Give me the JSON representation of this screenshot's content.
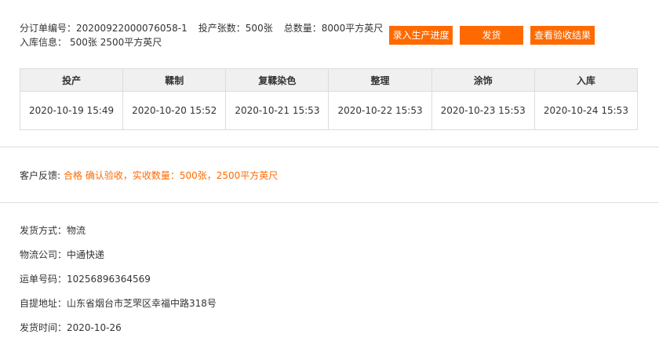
{
  "order": {
    "order_no_label": "分订单编号：",
    "order_no": "20200922000076058-1",
    "sheets_label": "投产张数：",
    "sheets": "500张",
    "total_label": "总数量：",
    "total": "8000平方英尺",
    "storage_label": "入库信息：",
    "storage": "500张 2500平方英尺"
  },
  "actions": {
    "record_progress": "录入生产进度",
    "ship": "发货",
    "view_result": "查看验收结果"
  },
  "steps": {
    "headers": [
      "投产",
      "鞣制",
      "复鞣染色",
      "整理",
      "涂饰",
      "入库"
    ],
    "times": [
      "2020-10-19 15:49",
      "2020-10-20 15:52",
      "2020-10-21 15:53",
      "2020-10-22 15:53",
      "2020-10-23 15:53",
      "2020-10-24 15:53"
    ]
  },
  "feedback": {
    "label": "客户反馈:",
    "value": "合格  确认验收，实收数量：500张，2500平方英尺"
  },
  "shipping": {
    "method_label": "发货方式：",
    "method": "物流",
    "company_label": "物流公司：",
    "company": "中通快递",
    "waybill_label": "运单号码：",
    "waybill": "10256896364569",
    "address_label": "自提地址：",
    "address": "山东省烟台市芝罘区幸福中路318号",
    "time_label": "发货时间：",
    "time": "2020-10-26"
  },
  "colors": {
    "accent": "#ff6a00",
    "header_bg": "#f0f0f0",
    "border": "#dcdcdc"
  }
}
